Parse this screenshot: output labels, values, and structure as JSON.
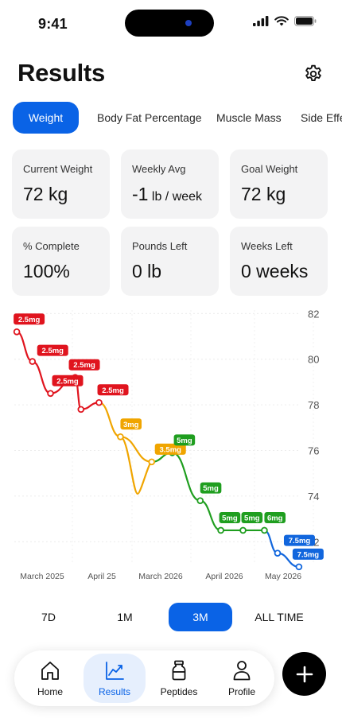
{
  "status_bar": {
    "time": "9:41"
  },
  "header": {
    "title": "Results"
  },
  "tabs": [
    {
      "label": "Weight",
      "active": true
    },
    {
      "label": "Body Fat Percentage",
      "active": false
    },
    {
      "label": "Muscle Mass",
      "active": false
    },
    {
      "label": "Side Effe",
      "active": false
    }
  ],
  "stats": [
    {
      "label": "Current Weight",
      "value": "72 kg",
      "unit": ""
    },
    {
      "label": "Weekly Avg",
      "value": "-1",
      "unit": " lb / week"
    },
    {
      "label": "Goal Weight",
      "value": "72 kg",
      "unit": ""
    },
    {
      "label": "% Complete",
      "value": "100%",
      "unit": ""
    },
    {
      "label": "Pounds Left",
      "value": "0 lb",
      "unit": ""
    },
    {
      "label": "Weeks Left",
      "value": "0 weeks",
      "unit": ""
    }
  ],
  "chart_data": {
    "type": "line",
    "x_ticks": [
      "March 2025",
      "April 25",
      "March 2026",
      "April 2026",
      "May 2026"
    ],
    "y_ticks": [
      72,
      74,
      76,
      78,
      80,
      82
    ],
    "ylim": [
      71,
      82.5
    ],
    "grid": true,
    "dose_colors": {
      "2.5mg": "#e0141e",
      "3mg": "#f0a500",
      "3.5mg": "#f0a500",
      "5mg": "#1f9e1f",
      "6mg": "#1f9e1f",
      "7.5mg": "#1166dd"
    },
    "points": [
      {
        "x": 0.3,
        "y": 81.2,
        "dose": "2.5mg"
      },
      {
        "x": 2.2,
        "y": 79.9,
        "dose": "2.5mg"
      },
      {
        "x": 4.4,
        "y": 78.5,
        "dose": "2.5mg"
      },
      {
        "x": 7.4,
        "y": 79.2,
        "dose": "2.5mg"
      },
      {
        "x": 8.1,
        "y": 77.8,
        "dose": "2.5mg"
      },
      {
        "x": 10.3,
        "y": 78.1,
        "dose": "2.5mg"
      },
      {
        "x": 12.9,
        "y": 76.6,
        "dose": "3mg"
      },
      {
        "x": 16.7,
        "y": 75.5,
        "dose": "3.5mg"
      },
      {
        "x": 19.2,
        "y": 75.9,
        "dose": "5mg"
      },
      {
        "x": 22.6,
        "y": 73.8,
        "dose": "5mg"
      },
      {
        "x": 25.1,
        "y": 72.5,
        "dose": "5mg"
      },
      {
        "x": 27.8,
        "y": 72.5,
        "dose": "5mg"
      },
      {
        "x": 30.4,
        "y": 72.5,
        "dose": "6mg"
      },
      {
        "x": 32.0,
        "y": 71.5,
        "dose": "7.5mg"
      },
      {
        "x": 34.6,
        "y": 70.9,
        "dose": "7.5mg"
      }
    ],
    "labeled_points": [
      0,
      1,
      2,
      3,
      5,
      6,
      7,
      8,
      9,
      10,
      11,
      12,
      13,
      14
    ]
  },
  "ranges": [
    {
      "label": "7D",
      "active": false
    },
    {
      "label": "1M",
      "active": false
    },
    {
      "label": "3M",
      "active": true
    },
    {
      "label": "ALL TIME",
      "active": false
    }
  ],
  "nav": [
    {
      "label": "Home",
      "icon": "home-icon",
      "active": false
    },
    {
      "label": "Results",
      "icon": "chart-icon",
      "active": true
    },
    {
      "label": "Peptides",
      "icon": "vial-icon",
      "active": false
    },
    {
      "label": "Profile",
      "icon": "person-icon",
      "active": false
    }
  ],
  "fab": {
    "icon": "plus-icon"
  },
  "colors": {
    "accent": "#0a63e6",
    "card_bg": "#f3f3f4"
  }
}
